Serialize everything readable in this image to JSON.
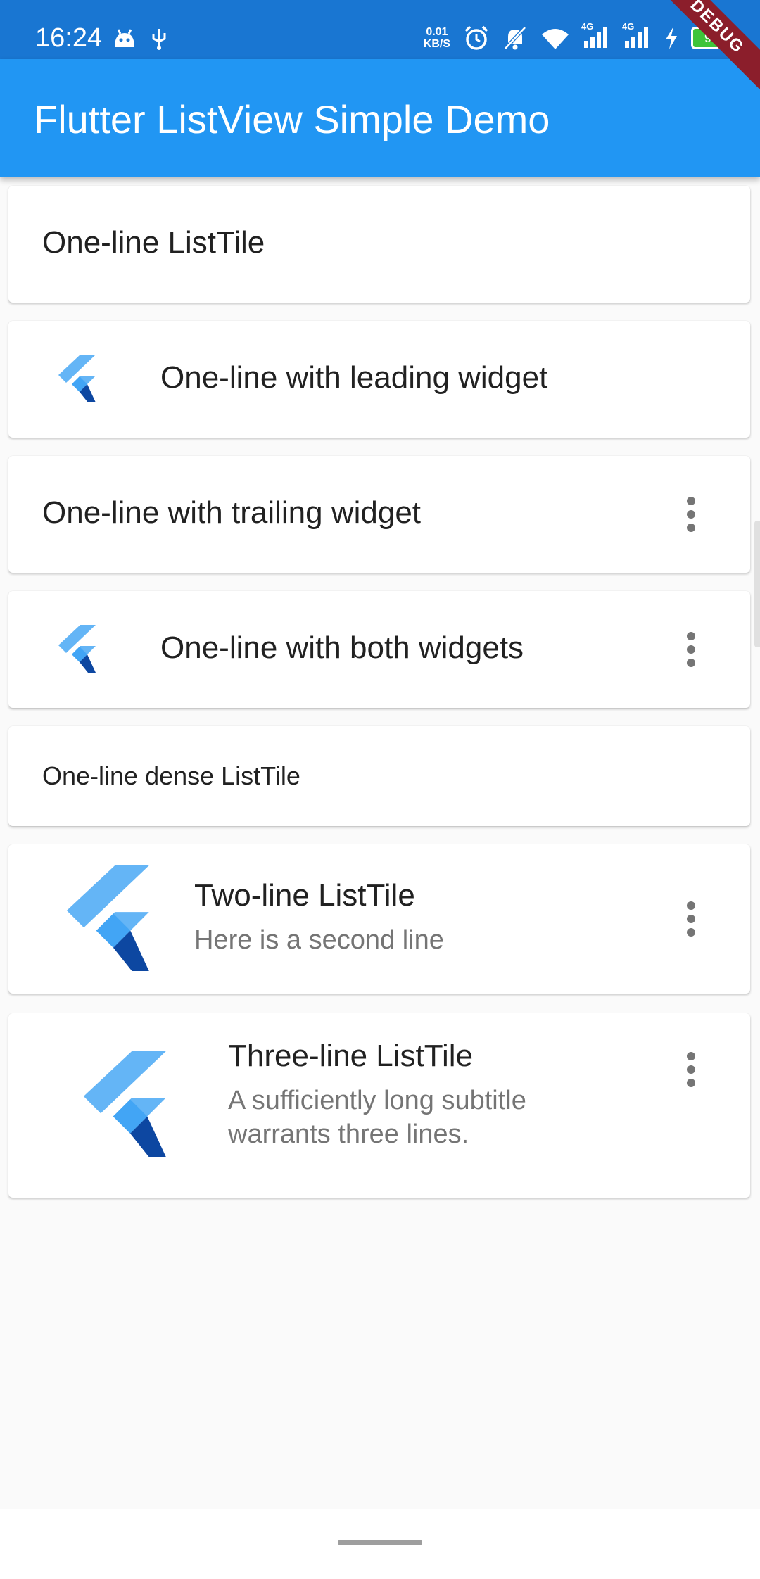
{
  "status_bar": {
    "time": "16:24",
    "net_speed_value": "0.01",
    "net_speed_unit": "KB/S",
    "signal_1_label": "4G",
    "signal_2_label": "4G",
    "battery_level": "97",
    "left_icons": [
      "android-icon",
      "usb-icon"
    ],
    "right_icons": [
      "alarm-icon",
      "notifications-off-icon",
      "wifi-icon",
      "signal-icon",
      "signal-icon",
      "charging-icon",
      "battery-icon"
    ]
  },
  "debug_banner": "DEBUG",
  "app_bar": {
    "title": "Flutter ListView Simple Demo",
    "color": "#2196f3"
  },
  "list": {
    "items": [
      {
        "title": "One-line ListTile"
      },
      {
        "title": "One-line with leading widget",
        "leading_icon": "flutter-logo-icon"
      },
      {
        "title": "One-line with trailing widget",
        "trailing_icon": "more-vert-icon"
      },
      {
        "title": "One-line with both widgets",
        "leading_icon": "flutter-logo-icon",
        "trailing_icon": "more-vert-icon"
      },
      {
        "title": "One-line dense ListTile"
      },
      {
        "title": "Two-line ListTile",
        "subtitle": "Here is a second line",
        "leading_icon": "flutter-logo-icon",
        "trailing_icon": "more-vert-icon"
      },
      {
        "title": "Three-line ListTile",
        "subtitle_line1": "A sufficiently long subtitle",
        "subtitle_line2": "warrants three lines.",
        "leading_icon": "flutter-logo-icon",
        "trailing_icon": "more-vert-icon"
      }
    ]
  },
  "colors": {
    "flutter_light": "#64b5f6",
    "flutter_mid": "#42a5f5",
    "flutter_dark": "#0d47a1",
    "status_bar": "#1976d2"
  }
}
